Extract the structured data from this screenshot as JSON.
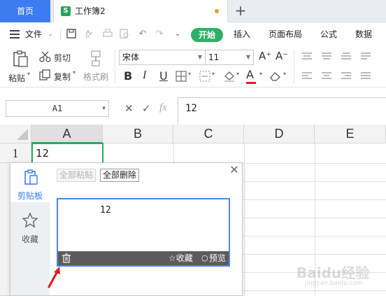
{
  "tabs": {
    "home_label": "首页",
    "doc_icon_letter": "S",
    "doc_name": "工作簿2",
    "add_label": "+"
  },
  "menu": {
    "file_label": "文件",
    "start_label": "开始",
    "items": [
      "插入",
      "页面布局",
      "公式",
      "数据"
    ]
  },
  "toolbar": {
    "paste_label": "粘贴",
    "cut_label": "剪切",
    "copy_label": "复制",
    "format_painter_label": "格式刷",
    "font_name": "宋体",
    "font_size": "11",
    "grow_font": "A⁺",
    "shrink_font": "A⁻",
    "bold": "B",
    "italic": "I",
    "underline": "U"
  },
  "formula_bar": {
    "name_box": "A1",
    "fx_label": "fx",
    "value": "12"
  },
  "grid": {
    "columns": [
      "A",
      "B",
      "C",
      "D",
      "E"
    ],
    "rows": [
      "1"
    ],
    "cell_a1": "12"
  },
  "clipboard": {
    "side_clipboard_label": "剪贴板",
    "side_favorites_label": "收藏",
    "paste_all_label": "全部粘贴",
    "delete_all_label": "全部删除",
    "item_text": "12",
    "item_favorite_label": "☆收藏",
    "item_preview_label": "预览"
  },
  "watermark": {
    "text": "Baidu经验",
    "sub": "jingyan.baidu.com"
  },
  "colors": {
    "accent_blue": "#3c7cf0",
    "start_green": "#2fb066",
    "selection_green": "#2fa760",
    "arrow_red": "#e02020"
  }
}
